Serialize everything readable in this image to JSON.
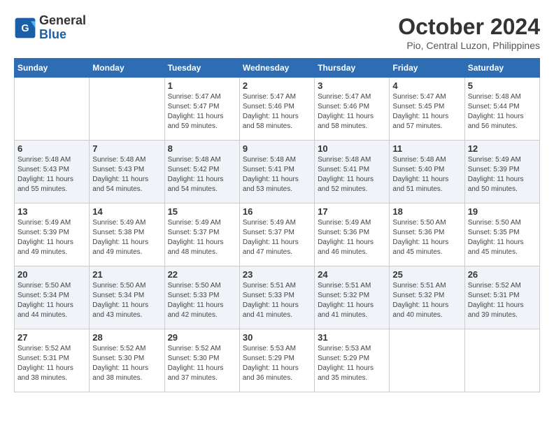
{
  "header": {
    "logo_line1": "General",
    "logo_line2": "Blue",
    "month": "October 2024",
    "location": "Pio, Central Luzon, Philippines"
  },
  "weekdays": [
    "Sunday",
    "Monday",
    "Tuesday",
    "Wednesday",
    "Thursday",
    "Friday",
    "Saturday"
  ],
  "weeks": [
    [
      {
        "day": "",
        "info": ""
      },
      {
        "day": "",
        "info": ""
      },
      {
        "day": "1",
        "info": "Sunrise: 5:47 AM\nSunset: 5:47 PM\nDaylight: 11 hours and 59 minutes."
      },
      {
        "day": "2",
        "info": "Sunrise: 5:47 AM\nSunset: 5:46 PM\nDaylight: 11 hours and 58 minutes."
      },
      {
        "day": "3",
        "info": "Sunrise: 5:47 AM\nSunset: 5:46 PM\nDaylight: 11 hours and 58 minutes."
      },
      {
        "day": "4",
        "info": "Sunrise: 5:47 AM\nSunset: 5:45 PM\nDaylight: 11 hours and 57 minutes."
      },
      {
        "day": "5",
        "info": "Sunrise: 5:48 AM\nSunset: 5:44 PM\nDaylight: 11 hours and 56 minutes."
      }
    ],
    [
      {
        "day": "6",
        "info": "Sunrise: 5:48 AM\nSunset: 5:43 PM\nDaylight: 11 hours and 55 minutes."
      },
      {
        "day": "7",
        "info": "Sunrise: 5:48 AM\nSunset: 5:43 PM\nDaylight: 11 hours and 54 minutes."
      },
      {
        "day": "8",
        "info": "Sunrise: 5:48 AM\nSunset: 5:42 PM\nDaylight: 11 hours and 54 minutes."
      },
      {
        "day": "9",
        "info": "Sunrise: 5:48 AM\nSunset: 5:41 PM\nDaylight: 11 hours and 53 minutes."
      },
      {
        "day": "10",
        "info": "Sunrise: 5:48 AM\nSunset: 5:41 PM\nDaylight: 11 hours and 52 minutes."
      },
      {
        "day": "11",
        "info": "Sunrise: 5:48 AM\nSunset: 5:40 PM\nDaylight: 11 hours and 51 minutes."
      },
      {
        "day": "12",
        "info": "Sunrise: 5:49 AM\nSunset: 5:39 PM\nDaylight: 11 hours and 50 minutes."
      }
    ],
    [
      {
        "day": "13",
        "info": "Sunrise: 5:49 AM\nSunset: 5:39 PM\nDaylight: 11 hours and 49 minutes."
      },
      {
        "day": "14",
        "info": "Sunrise: 5:49 AM\nSunset: 5:38 PM\nDaylight: 11 hours and 49 minutes."
      },
      {
        "day": "15",
        "info": "Sunrise: 5:49 AM\nSunset: 5:37 PM\nDaylight: 11 hours and 48 minutes."
      },
      {
        "day": "16",
        "info": "Sunrise: 5:49 AM\nSunset: 5:37 PM\nDaylight: 11 hours and 47 minutes."
      },
      {
        "day": "17",
        "info": "Sunrise: 5:49 AM\nSunset: 5:36 PM\nDaylight: 11 hours and 46 minutes."
      },
      {
        "day": "18",
        "info": "Sunrise: 5:50 AM\nSunset: 5:36 PM\nDaylight: 11 hours and 45 minutes."
      },
      {
        "day": "19",
        "info": "Sunrise: 5:50 AM\nSunset: 5:35 PM\nDaylight: 11 hours and 45 minutes."
      }
    ],
    [
      {
        "day": "20",
        "info": "Sunrise: 5:50 AM\nSunset: 5:34 PM\nDaylight: 11 hours and 44 minutes."
      },
      {
        "day": "21",
        "info": "Sunrise: 5:50 AM\nSunset: 5:34 PM\nDaylight: 11 hours and 43 minutes."
      },
      {
        "day": "22",
        "info": "Sunrise: 5:50 AM\nSunset: 5:33 PM\nDaylight: 11 hours and 42 minutes."
      },
      {
        "day": "23",
        "info": "Sunrise: 5:51 AM\nSunset: 5:33 PM\nDaylight: 11 hours and 41 minutes."
      },
      {
        "day": "24",
        "info": "Sunrise: 5:51 AM\nSunset: 5:32 PM\nDaylight: 11 hours and 41 minutes."
      },
      {
        "day": "25",
        "info": "Sunrise: 5:51 AM\nSunset: 5:32 PM\nDaylight: 11 hours and 40 minutes."
      },
      {
        "day": "26",
        "info": "Sunrise: 5:52 AM\nSunset: 5:31 PM\nDaylight: 11 hours and 39 minutes."
      }
    ],
    [
      {
        "day": "27",
        "info": "Sunrise: 5:52 AM\nSunset: 5:31 PM\nDaylight: 11 hours and 38 minutes."
      },
      {
        "day": "28",
        "info": "Sunrise: 5:52 AM\nSunset: 5:30 PM\nDaylight: 11 hours and 38 minutes."
      },
      {
        "day": "29",
        "info": "Sunrise: 5:52 AM\nSunset: 5:30 PM\nDaylight: 11 hours and 37 minutes."
      },
      {
        "day": "30",
        "info": "Sunrise: 5:53 AM\nSunset: 5:29 PM\nDaylight: 11 hours and 36 minutes."
      },
      {
        "day": "31",
        "info": "Sunrise: 5:53 AM\nSunset: 5:29 PM\nDaylight: 11 hours and 35 minutes."
      },
      {
        "day": "",
        "info": ""
      },
      {
        "day": "",
        "info": ""
      }
    ]
  ]
}
